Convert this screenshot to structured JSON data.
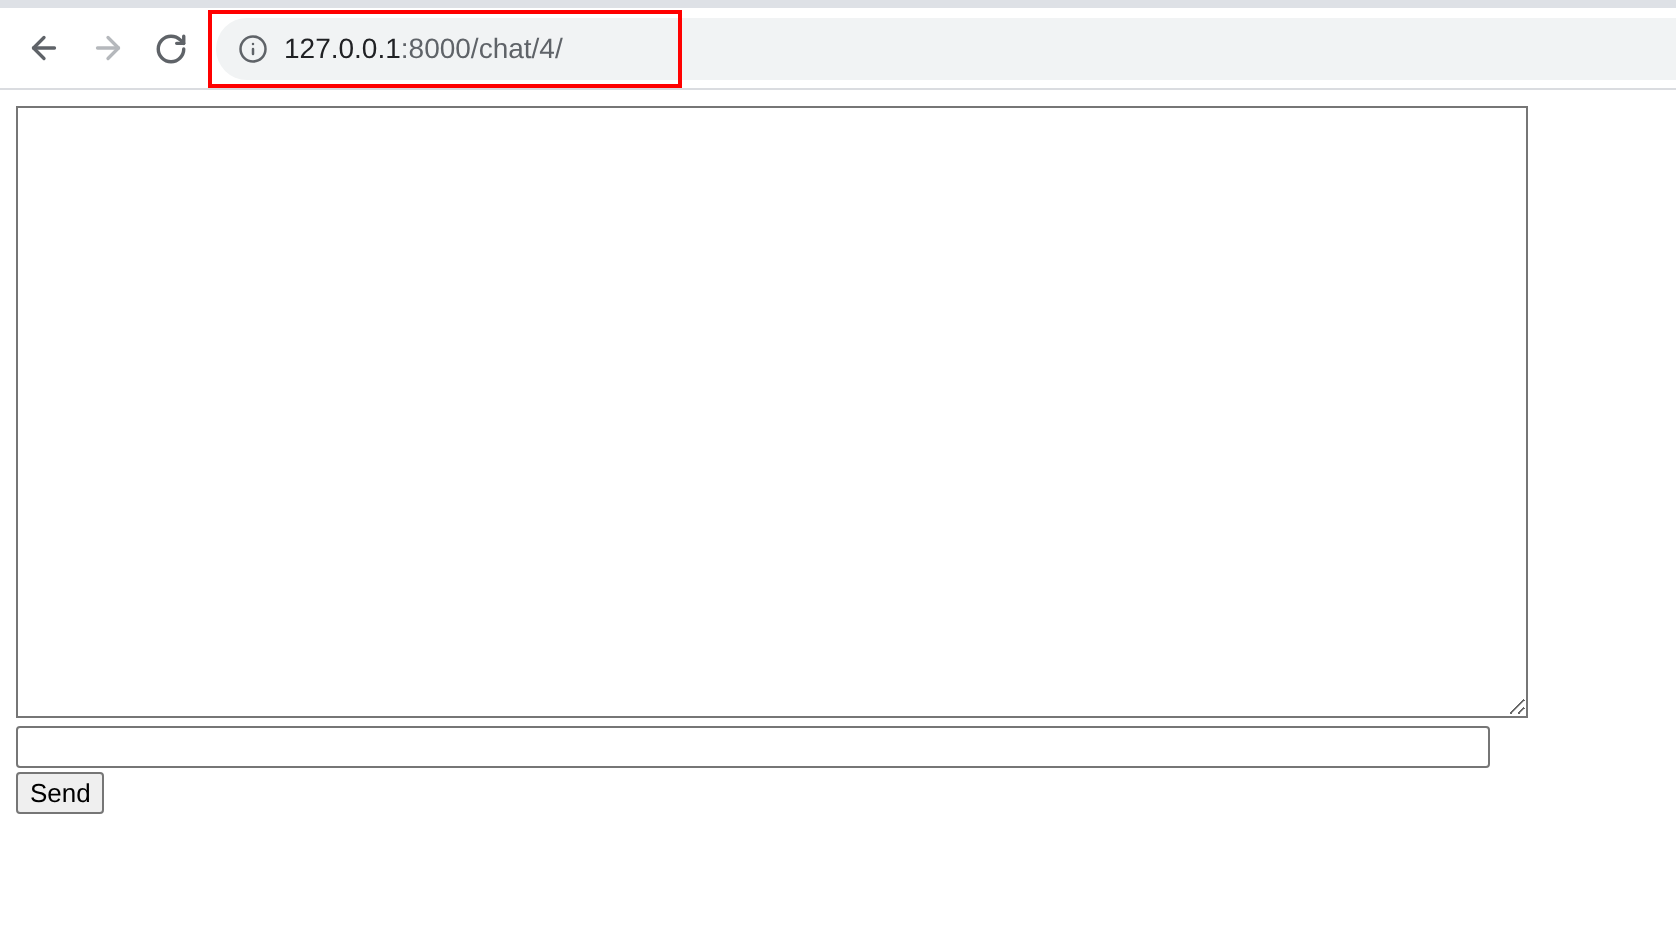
{
  "browser": {
    "url_host": "127.0.0.1",
    "url_path": ":8000/chat/4/"
  },
  "send_button": {
    "label": "Send"
  }
}
